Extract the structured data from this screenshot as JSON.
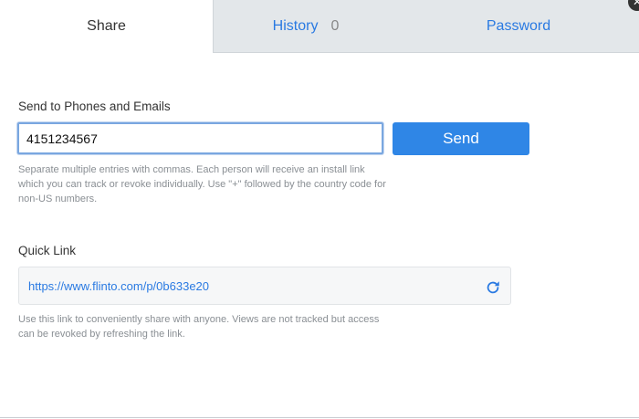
{
  "tabs": {
    "share": "Share",
    "history": "History",
    "history_count": "0",
    "password": "Password"
  },
  "close_icon": "close-icon",
  "send": {
    "label": "Send to Phones and Emails",
    "input_value": "4151234567",
    "button": "Send",
    "help": "Separate multiple entries with commas. Each person will receive an install link which you can track or revoke individually. Use \"+\" followed by the country code for non-US numbers."
  },
  "quick_link": {
    "label": "Quick Link",
    "url": "https://www.flinto.com/p/0b633e20",
    "refresh_icon": "refresh-icon",
    "help": "Use this link to conveniently share with anyone. Views are not tracked but access can be revoked by refreshing the link."
  },
  "colors": {
    "accent": "#2f86e6",
    "tab_inactive_bg": "#e3e7ea",
    "link": "#2a7ae2"
  }
}
